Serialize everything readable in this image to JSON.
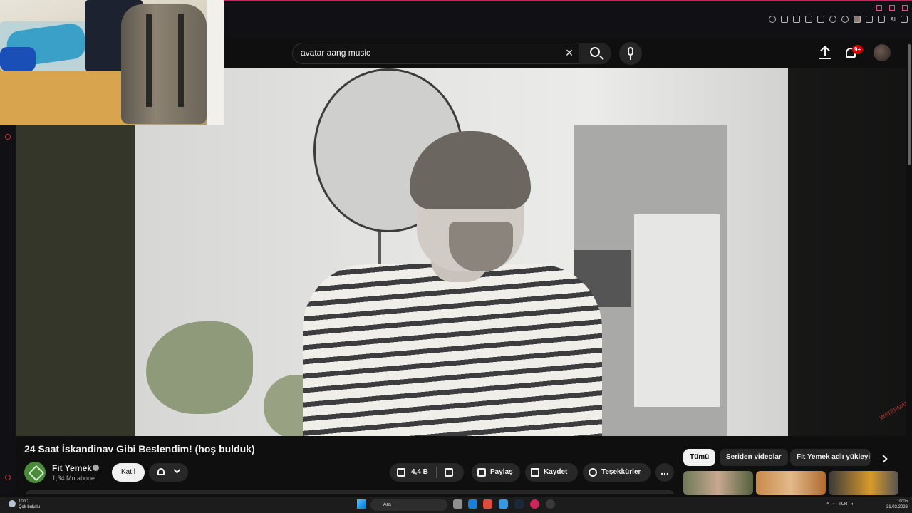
{
  "search": {
    "query": "avatar aang music"
  },
  "header": {
    "notifications_badge": "9+"
  },
  "browser": {
    "ai_label": "AI"
  },
  "video": {
    "title": "24 Saat İskandinav Gibi Beslendim! (hoş bulduk)",
    "channel_name": "Fit Yemek",
    "subscribers": "1,34 Mn abone",
    "join_label": "Katıl",
    "likes": "4,4 B",
    "share_label": "Paylaş",
    "save_label": "Kaydet",
    "thanks_label": "Teşekkürler",
    "more_label": "..."
  },
  "related": {
    "chips": [
      "Tümü",
      "Seriden videolar",
      "Fit Yemek adlı yükleyi"
    ]
  },
  "taskbar": {
    "weather_temp": "10°C",
    "weather_desc": "Çok bulutlu",
    "search_placeholder": "Ara",
    "language": "TUR",
    "time": "10:05",
    "date": "31.03.2026"
  },
  "colors": {
    "accent": "#c0265a",
    "badge": "#cc0000",
    "background": "#0f0f0f"
  }
}
